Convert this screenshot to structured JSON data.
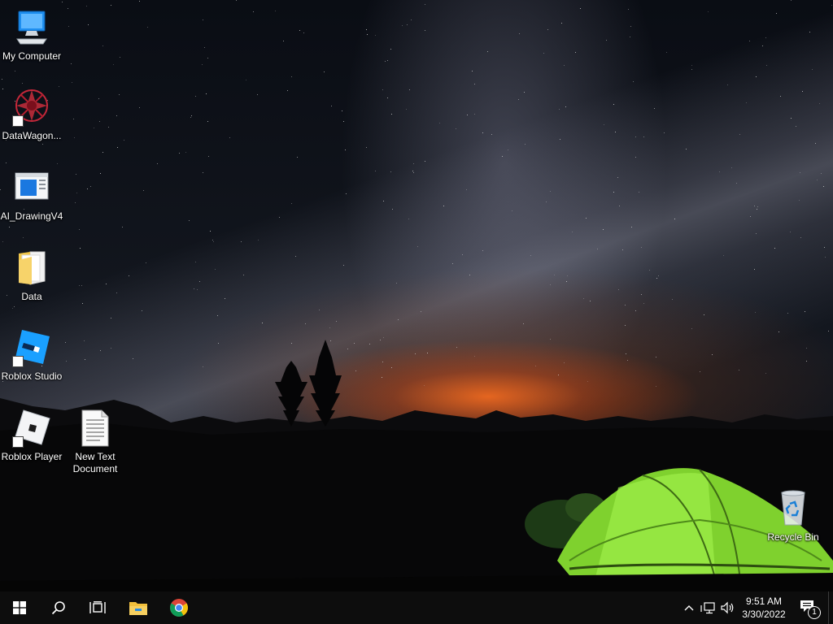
{
  "desktop": {
    "icons": [
      {
        "label": "My Computer",
        "icon": "computer-icon"
      },
      {
        "label": "DataWagon...",
        "icon": "datawagon-icon"
      },
      {
        "label": "AI_DrawingV4",
        "icon": "ai-drawing-icon"
      },
      {
        "label": "Data",
        "icon": "folder-icon"
      },
      {
        "label": "Roblox Studio",
        "icon": "roblox-studio-icon"
      },
      {
        "label": "Roblox Player",
        "icon": "roblox-player-icon"
      },
      {
        "label": "New Text\nDocument",
        "icon": "text-document-icon"
      },
      {
        "label": "Recycle Bin",
        "icon": "recycle-bin-icon"
      }
    ]
  },
  "taskbar": {
    "start": "windows-start-icon",
    "search": "search-icon",
    "task_view": "task-view-icon",
    "pinned": [
      "file-explorer-icon",
      "chrome-icon"
    ],
    "tray": {
      "chevron": "show-hidden-icons-chevron",
      "network": "network-icon",
      "volume": "volume-icon",
      "time": "9:51 AM",
      "date": "3/30/2022",
      "notifications_count": "1"
    }
  },
  "colors": {
    "taskbar_bg": "#0d0d0d",
    "tent_green": "#8fe23a",
    "horizon_glow": "#ff6a1e"
  }
}
